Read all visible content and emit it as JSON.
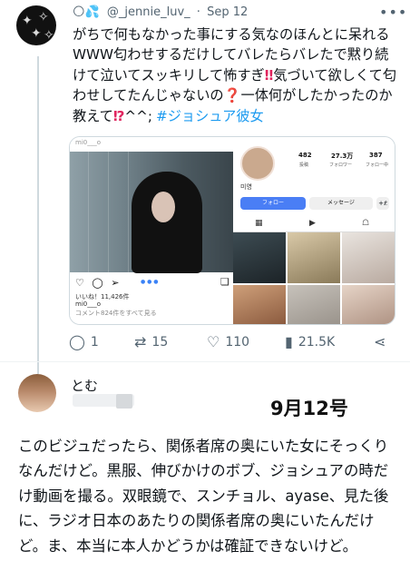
{
  "tweet": {
    "display_name_emojis": "🌕💦",
    "handle": "@_jennie_luv_",
    "separator": "·",
    "date": "Sep 12",
    "text_parts": [
      "がちで何もなかった事にする気なのほんとに呆れるWWW匂わせするだけしてバレたらバレたで黙り続けて泣いてスッキリして怖すぎ",
      "‼",
      "気づいて欲しくて匂わせしてたんじゃないの",
      "❓",
      "一体何がしたかったのか教えて",
      "⁉",
      "^^;",
      "#ジョシュア彼女"
    ],
    "more_icon": "more-dots-icon",
    "embedded_post": {
      "likes_line": "いいね！11,426件",
      "username_line": "mi0___o",
      "comments_line": "コメント824件をすべて見る",
      "top_handle": "mi0___o",
      "profile_name": "미영",
      "stats": [
        {
          "num": "482",
          "label": "投稿"
        },
        {
          "num": "27.3万",
          "label": "フォロワー"
        },
        {
          "num": "387",
          "label": "フォロー中"
        }
      ],
      "follow_label": "フォロー",
      "message_label": "メッセージ",
      "add_label": "+ደ"
    },
    "actions": {
      "replies": "1",
      "retweets": "15",
      "likes": "110",
      "views": "21.5K"
    }
  },
  "reply": {
    "name": "とむ",
    "date_label": "9月12号",
    "text": "このビジュだったら、関係者席の奥にいた女にそっくりなんだけど。黒服、伸びかけのボブ、ジョシュアの時だけ動画を撮る。双眼鏡で、スンチョル、ayase、見た後に、ラジオ日本のあたりの関係者席の奥にいたんだけど。ま、本当に本人かどうかは確証できないけど。"
  },
  "colors": {
    "accent": "#1d9bf0",
    "text": "#0f1419",
    "muted": "#536471",
    "instagram_blue": "#4a7ef5"
  }
}
